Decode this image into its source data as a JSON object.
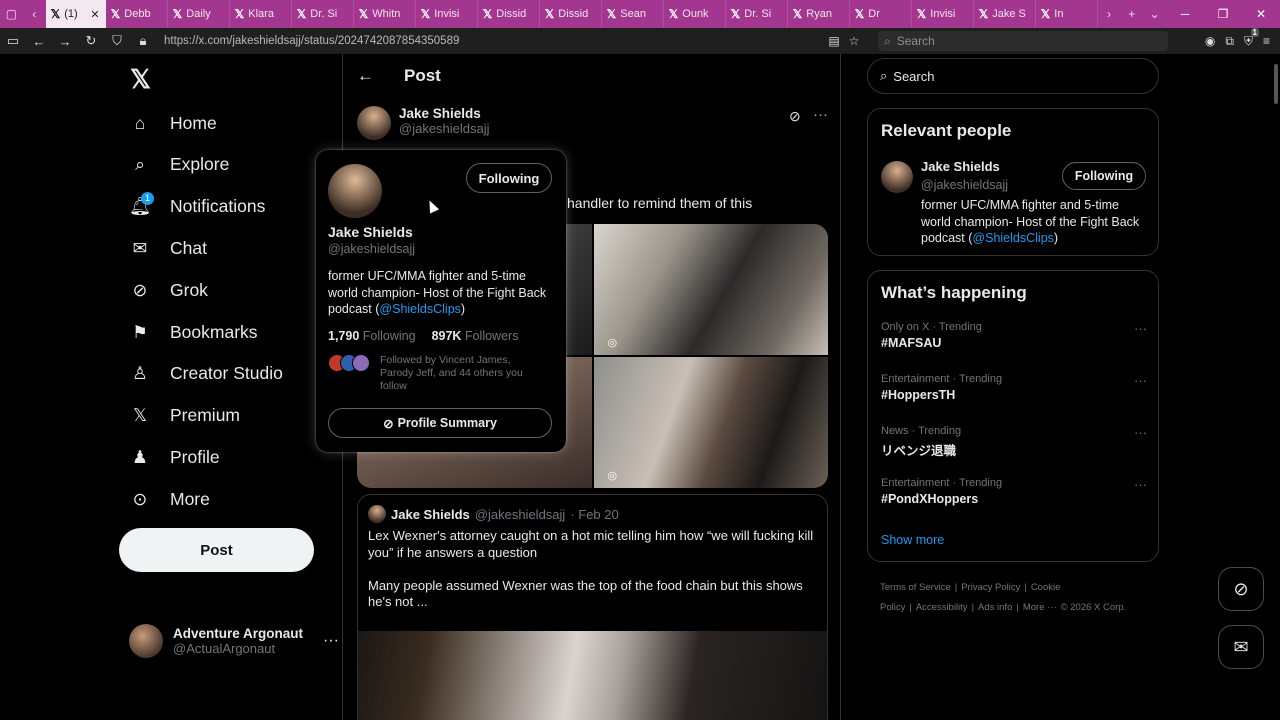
{
  "browser": {
    "tabs": [
      {
        "label": "(1)",
        "active": true
      },
      {
        "label": "Debb"
      },
      {
        "label": "Daily"
      },
      {
        "label": "Klara"
      },
      {
        "label": "Dr. Si"
      },
      {
        "label": "Whitn"
      },
      {
        "label": "Invisi"
      },
      {
        "label": "Dissid"
      },
      {
        "label": "Dissid"
      },
      {
        "label": "Sean"
      },
      {
        "label": "Ounk"
      },
      {
        "label": "Dr. Si"
      },
      {
        "label": "Ryan"
      },
      {
        "label": "Dr"
      },
      {
        "label": "Invisi"
      },
      {
        "label": "Jake S"
      },
      {
        "label": "In"
      }
    ],
    "url": "https://x.com/jakeshieldsajj/status/2024742087854350589",
    "search_placeholder": "Search"
  },
  "sidebar": {
    "items": [
      {
        "label": "Home",
        "icon": "home-icon"
      },
      {
        "label": "Explore",
        "icon": "search-icon"
      },
      {
        "label": "Notifications",
        "icon": "bell-icon",
        "badge": "1"
      },
      {
        "label": "Chat",
        "icon": "mail-icon"
      },
      {
        "label": "Grok",
        "icon": "grok-icon"
      },
      {
        "label": "Bookmarks",
        "icon": "bookmark-icon"
      },
      {
        "label": "Creator Studio",
        "icon": "creator-icon"
      },
      {
        "label": "Premium",
        "icon": "x-icon"
      },
      {
        "label": "Profile",
        "icon": "person-icon"
      },
      {
        "label": "More",
        "icon": "more-icon"
      }
    ],
    "post_button": "Post",
    "account": {
      "name": "Adventure Argonaut",
      "handle": "@ActualArgonaut"
    }
  },
  "main": {
    "header_title": "Post",
    "author": {
      "name": "Jake Shields",
      "handle": "@jakeshieldsajj"
    },
    "tweet_text_visible": "handler to remind them of this",
    "quote": {
      "name": "Jake Shields",
      "handle": "@jakeshieldsajj",
      "date": "· Feb 20",
      "text": "Lex Wexner's attorney caught on a hot mic telling him how “we will fucking kill you” if he answers a question\n\nMany people assumed Wexner was the top of the food chain but this shows he's not ..."
    }
  },
  "hover_card": {
    "follow_button": "Following",
    "name": "Jake Shields",
    "handle": "@jakeshieldsajj",
    "bio_prefix": "former UFC/MMA fighter and 5-time world champion- Host of the Fight Back podcast (",
    "bio_link": "@ShieldsClips",
    "bio_suffix": ")",
    "following_count": "1,790",
    "following_label": "Following",
    "followers_count": "897K",
    "followers_label": "Followers",
    "followed_by": "Followed by Vincent James, Parody Jeff, and 44 others you follow",
    "summary_button": "Profile Summary"
  },
  "right": {
    "search_placeholder": "Search",
    "relevant": {
      "title": "Relevant people",
      "name": "Jake Shields",
      "handle": "@jakeshieldsajj",
      "follow_button": "Following",
      "bio_prefix": "former UFC/MMA fighter and 5-time world champion- Host of the Fight Back podcast (",
      "bio_link": "@ShieldsClips",
      "bio_suffix": ")"
    },
    "happening": {
      "title": "What’s happening",
      "trends": [
        {
          "context": "Only on X · Trending",
          "title": "#MAFSAU"
        },
        {
          "context": "Entertainment · Trending",
          "title": "#HoppersTH"
        },
        {
          "context": "News · Trending",
          "title": "リベンジ退職"
        },
        {
          "context": "Entertainment · Trending",
          "title": "#PondXHoppers"
        }
      ],
      "show_more": "Show more"
    },
    "footer": [
      "Terms of Service",
      "|",
      "Privacy Policy",
      "|",
      "Cookie Policy",
      "|",
      "Accessibility",
      "|",
      "Ads info",
      "|",
      "More ···",
      "© 2026 X Corp."
    ]
  }
}
